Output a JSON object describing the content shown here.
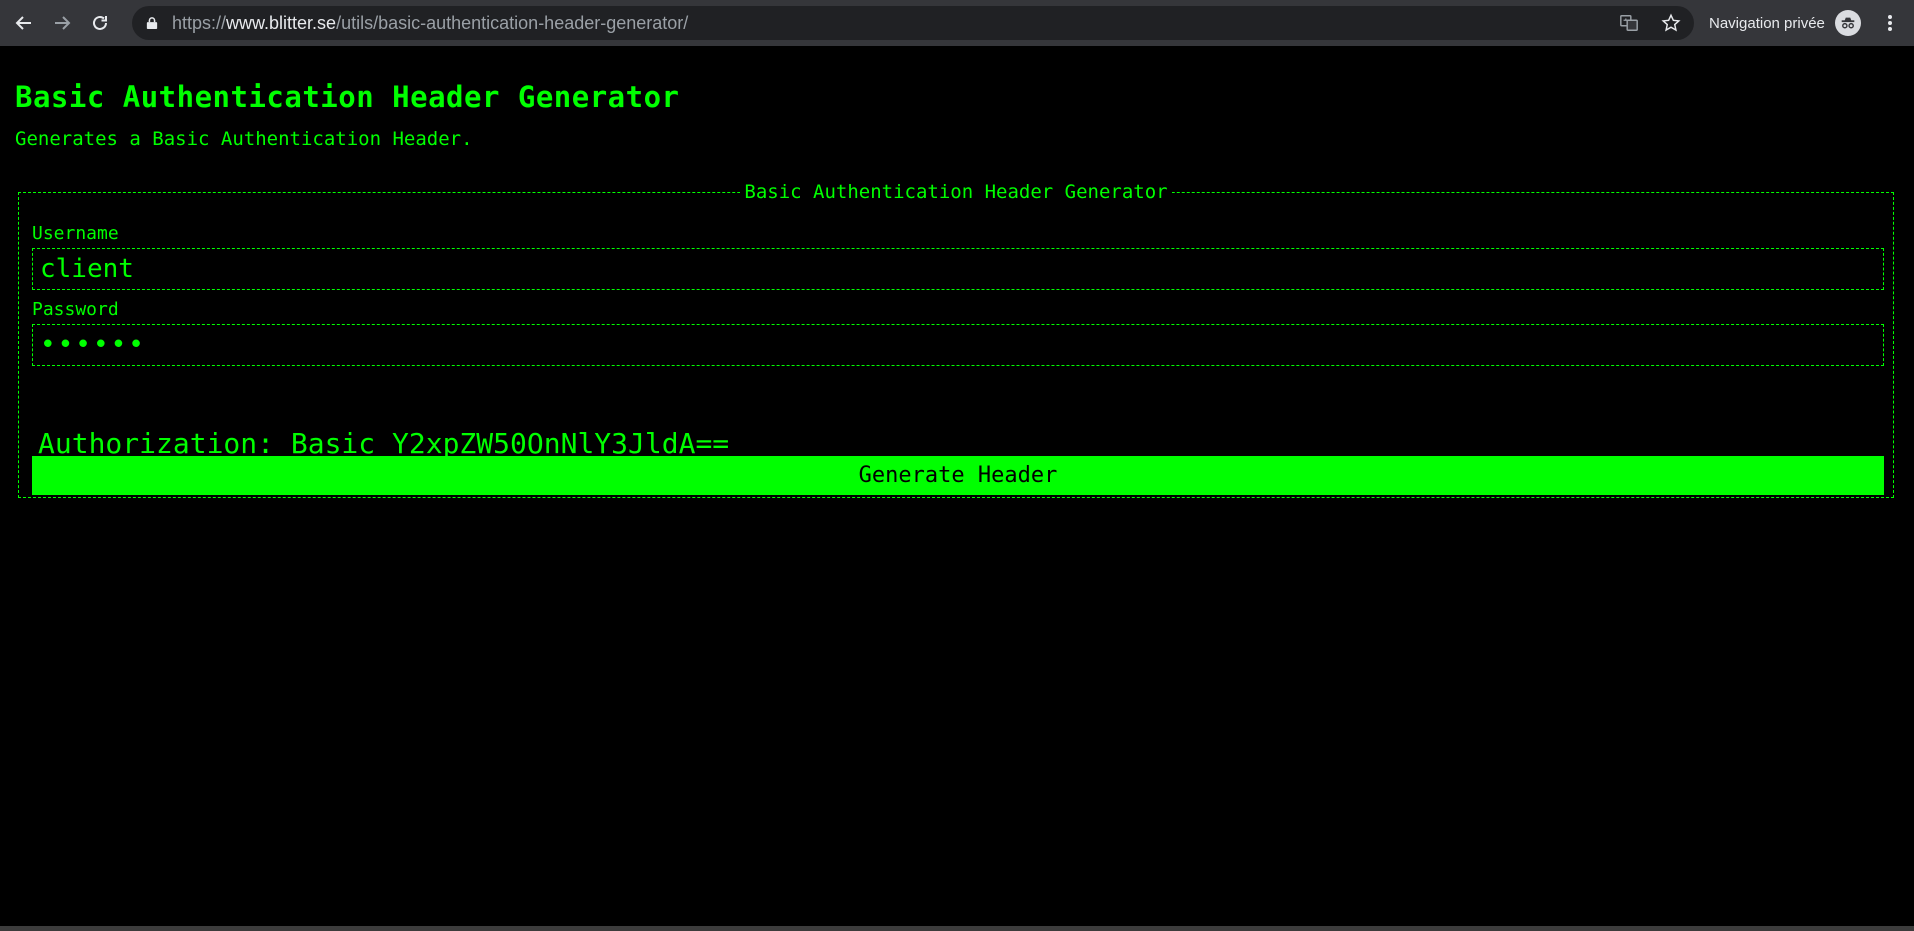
{
  "browser": {
    "url_scheme": "https://",
    "url_host": "www.blitter.se",
    "url_path": "/utils/basic-authentication-header-generator/",
    "private_label": "Navigation privée"
  },
  "page": {
    "title": "Basic Authentication Header Generator",
    "subtitle": "Generates a Basic Authentication Header."
  },
  "form": {
    "legend": "Basic Authentication Header Generator",
    "username_label": "Username",
    "username_value": "client",
    "password_label": "Password",
    "password_display": "••••••",
    "result_text": "Authorization: Basic Y2xpZW50OnNlY3JldA==",
    "button_label": "Generate Header"
  },
  "colors": {
    "accent": "#00ff00",
    "background": "#000000",
    "chrome": "#35363a"
  }
}
